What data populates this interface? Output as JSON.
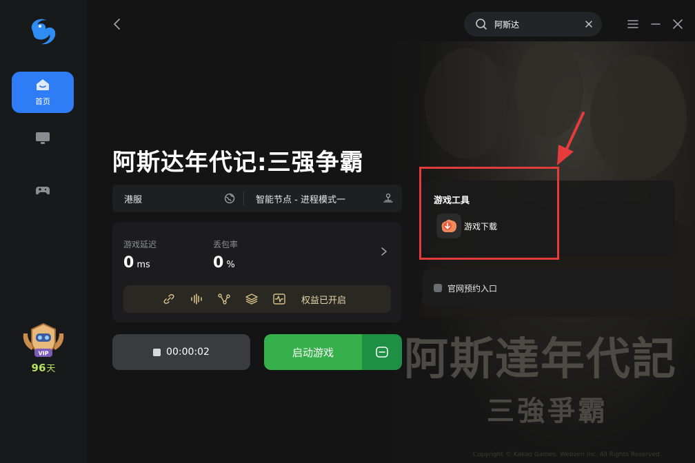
{
  "sidebar": {
    "items": [
      {
        "label": "首页",
        "icon": "home-icon",
        "active": true
      },
      {
        "label": "",
        "icon": "monitor-icon",
        "active": false
      },
      {
        "label": "",
        "icon": "gamepad-icon",
        "active": false
      }
    ],
    "vip": {
      "badge_text": "VIP",
      "days": "96",
      "unit": "天"
    }
  },
  "search": {
    "value": "阿斯达",
    "placeholder": ""
  },
  "game": {
    "title": "阿斯达年代记:三强争霸",
    "server": "港服",
    "node": "智能节点 - 进程模式一"
  },
  "stats": {
    "latency_label": "游戏延迟",
    "latency_value": "0",
    "latency_unit": "ms",
    "loss_label": "丢包率",
    "loss_value": "0",
    "loss_unit": "%",
    "perks_text": "权益已开启"
  },
  "actions": {
    "timer": "00:00:02",
    "launch_label": "启动游戏"
  },
  "tools": {
    "title": "游戏工具",
    "items": [
      {
        "label": "游戏下载",
        "icon": "download-icon"
      }
    ]
  },
  "site": {
    "label": "官网预约入口"
  },
  "artwork": {
    "title": "阿斯達年代記",
    "subtitle": "三強爭霸",
    "copyright": "Copyright © Kakao Games. Webzen Inc. All Rights Reserved."
  },
  "colors": {
    "accent_blue": "#2e7cf6",
    "launch_green": "#35b04a",
    "highlight_red": "#e43b3b",
    "vip_green": "#b6e35a"
  }
}
